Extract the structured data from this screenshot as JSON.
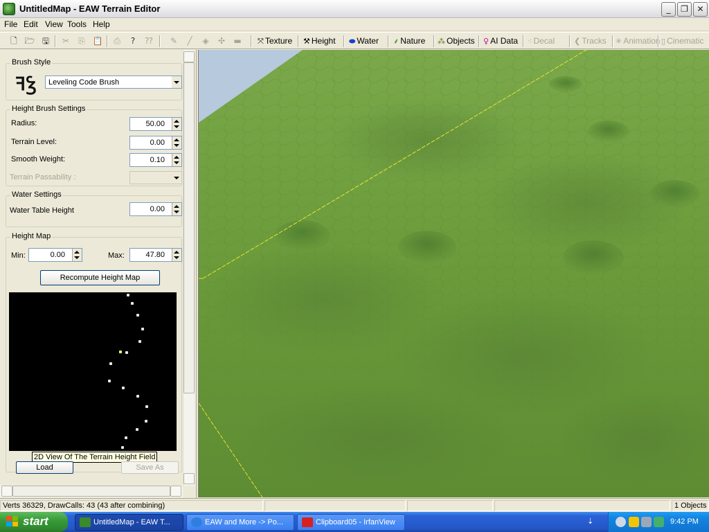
{
  "window": {
    "title": "UntitledMap - EAW Terrain Editor",
    "controls": {
      "minimize": "_",
      "maximize": "❐",
      "close": "✕"
    }
  },
  "menu": [
    "File",
    "Edit",
    "View",
    "Tools",
    "Help"
  ],
  "toolbar": {
    "icons": [
      "new-file-icon",
      "open-folder-icon",
      "save-icon",
      "cut-icon",
      "copy-icon",
      "paste-icon",
      "print-icon",
      "help-icon",
      "context-help-icon",
      "pencil-icon",
      "line-icon",
      "fill-icon",
      "select-icon",
      "eraser-icon"
    ],
    "modes": [
      {
        "label": "Texture",
        "icon": "texture-icon",
        "enabled": true
      },
      {
        "label": "Height",
        "icon": "height-icon",
        "enabled": true
      },
      {
        "label": "Water",
        "icon": "water-icon",
        "enabled": true
      },
      {
        "label": "Nature",
        "icon": "nature-icon",
        "enabled": true
      },
      {
        "label": "Objects",
        "icon": "objects-icon",
        "enabled": true
      },
      {
        "label": "AI Data",
        "icon": "ai-data-icon",
        "enabled": true
      },
      {
        "label": "Decal",
        "icon": "decal-icon",
        "enabled": false
      },
      {
        "label": "Tracks",
        "icon": "tracks-icon",
        "enabled": false
      },
      {
        "label": "Animation",
        "icon": "animation-icon",
        "enabled": false
      },
      {
        "label": "Cinematic",
        "icon": "cinematic-icon",
        "enabled": false
      }
    ]
  },
  "panel": {
    "brush_style": {
      "title": "Brush Style",
      "selected": "Leveling Code Brush"
    },
    "height_brush": {
      "title": "Height Brush Settings",
      "radius_label": "Radius:",
      "radius": "50.00",
      "terrain_level_label": "Terrain Level:",
      "terrain_level": "0.00",
      "smooth_weight_label": "Smooth Weight:",
      "smooth_weight": "0.10",
      "passability_label": "Terrain Passability :",
      "passability": ""
    },
    "water": {
      "title": "Water Settings",
      "table_height_label": "Water Table Height",
      "table_height": "0.00"
    },
    "height_map": {
      "title": "Height Map",
      "min_label": "Min:",
      "min": "0.00",
      "max_label": "Max:",
      "max": "47.80",
      "recompute": "Recompute Height Map",
      "tooltip": "2D View Of The Terrain Height Field",
      "load": "Load",
      "save_as": "Save As"
    }
  },
  "status": {
    "left": "Verts 36329, DrawCalls: 43 (43 after combining)",
    "pane2": "",
    "pane3": "",
    "pane4": "",
    "objects": "1 Objects"
  },
  "taskbar": {
    "start": "start",
    "tasks": [
      {
        "label": "UntitledMap - EAW T...",
        "active": true
      },
      {
        "label": "EAW and More -> Po...",
        "active": false
      },
      {
        "label": "Clipboard05 - IrfanView",
        "active": false
      }
    ],
    "clock": "9:42 PM"
  },
  "colors": {
    "terrain_green": "#6f9d3f",
    "sky": "#b7c9dc",
    "taskbar_blue": "#2457c8",
    "start_green": "#3a9b3a",
    "boundary_line": "#e6e632"
  }
}
